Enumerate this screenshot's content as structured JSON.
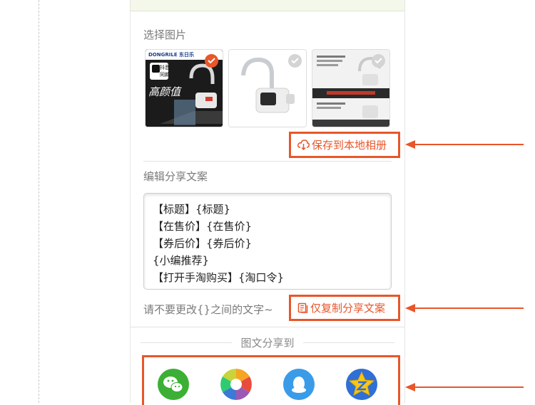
{
  "select_images": {
    "title": "选择图片",
    "thumbs": [
      {
        "brand": "DONGRILE 东日乐",
        "badge_line1": "抖音",
        "badge_line2": "同款",
        "slogan": "高颜值",
        "selected": true
      },
      {
        "selected": false
      },
      {
        "selected": false
      }
    ],
    "save_button": "保存到本地相册"
  },
  "edit_copy": {
    "title": "编辑分享文案",
    "lines": [
      "【标题】{标题}",
      "【在售价】{在售价}",
      "【券后价】{券后价}",
      "{小编推荐}",
      "【打开手淘购买】{淘口令}"
    ],
    "hint": "请不要更改{}之间的文字~",
    "copy_button": "仅复制分享文案"
  },
  "share": {
    "title": "图文分享到",
    "targets": [
      {
        "icon": "wechat-icon",
        "color": "#3cb034"
      },
      {
        "icon": "moments-icon",
        "color": "#f5a623"
      },
      {
        "icon": "qq-icon",
        "color": "#3a9be8"
      },
      {
        "icon": "qzone-icon",
        "color": "#f8c613"
      }
    ]
  },
  "colors": {
    "accent": "#e8562a",
    "top_band": "#f3f8ea"
  }
}
